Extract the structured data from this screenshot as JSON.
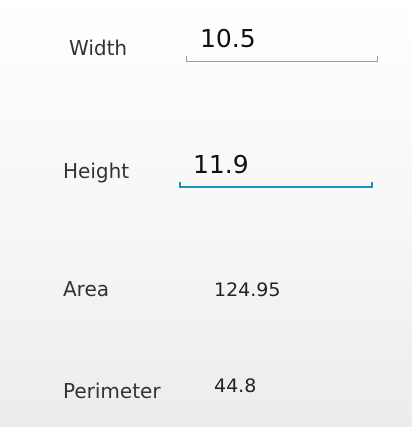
{
  "form": {
    "width": {
      "label": "Width",
      "value": "10.5"
    },
    "height": {
      "label": "Height",
      "value": "11.9"
    }
  },
  "results": {
    "area": {
      "label": "Area",
      "value": "124.95"
    },
    "perimeter": {
      "label": "Perimeter",
      "value": "44.8"
    }
  },
  "colors": {
    "focus_accent": "#1e90bd",
    "underline_idle": "#9a9a9a"
  }
}
